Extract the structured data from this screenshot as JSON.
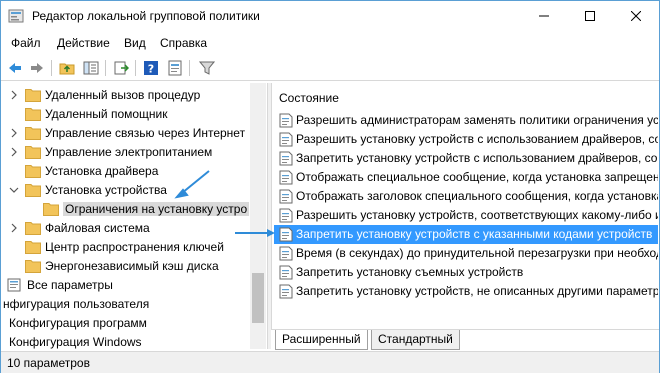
{
  "window": {
    "title": "Редактор локальной групповой политики",
    "icon": "gpedit-icon"
  },
  "menu": [
    "Файл",
    "Действие",
    "Вид",
    "Справка"
  ],
  "toolbar": {
    "icons": [
      "back-arrow-icon",
      "forward-arrow-icon",
      "up-folder-icon",
      "show-hide-tree-icon",
      "export-list-icon",
      "help-icon",
      "properties-icon",
      "filter-icon"
    ]
  },
  "tree": {
    "items": [
      {
        "label": "Удаленный вызов процедур",
        "expandable": true,
        "expanded": false,
        "indent": 1
      },
      {
        "label": "Удаленный помощник",
        "expandable": false,
        "expanded": false,
        "indent": 1
      },
      {
        "label": "Управление связью через Интернет",
        "expandable": true,
        "expanded": false,
        "indent": 1
      },
      {
        "label": "Управление электропитанием",
        "expandable": true,
        "expanded": false,
        "indent": 1
      },
      {
        "label": "Установка драйвера",
        "expandable": false,
        "expanded": false,
        "indent": 1
      },
      {
        "label": "Установка устройства",
        "expandable": true,
        "expanded": true,
        "indent": 1
      },
      {
        "label": "Ограничения на установку устро",
        "expandable": false,
        "expanded": false,
        "indent": 2,
        "selected": true
      },
      {
        "label": "Файловая система",
        "expandable": true,
        "expanded": false,
        "indent": 1
      },
      {
        "label": "Центр распространения ключей",
        "expandable": false,
        "expanded": false,
        "indent": 1
      },
      {
        "label": "Энергонезависимый кэш диска",
        "expandable": false,
        "expanded": false,
        "indent": 1
      },
      {
        "label": "Все параметры",
        "expandable": false,
        "expanded": false,
        "indent": 0,
        "icon": "all-settings-icon"
      },
      {
        "label": "нфигурация пользователя",
        "expandable": false,
        "expanded": false,
        "indent": -1,
        "icon": "none"
      },
      {
        "label": "Конфигурация программ",
        "expandable": false,
        "expanded": false,
        "indent": -1,
        "icon": "none"
      },
      {
        "label": "Конфигурация Windows",
        "expandable": false,
        "expanded": false,
        "indent": -1,
        "icon": "none"
      }
    ]
  },
  "list": {
    "header": "Состояние",
    "items": [
      {
        "label": "Разрешить администраторам заменять политики ограничения устр",
        "selected": false
      },
      {
        "label": "Разрешить установку устройств с использованием драйверов, соот",
        "selected": false
      },
      {
        "label": "Запретить установку устройств с использованием драйверов, соот",
        "selected": false
      },
      {
        "label": "Отображать специальное сообщение, когда установка запрещена п",
        "selected": false
      },
      {
        "label": "Отображать заголовок специального сообщения, когда установка",
        "selected": false
      },
      {
        "label": "Разрешить установку устройств, соответствующих какому-либо из",
        "selected": false
      },
      {
        "label": "Запретить установку устройств с указанными кодами устройств",
        "selected": true
      },
      {
        "label": "Время (в секундах) до принудительной перезагрузки при необход",
        "selected": false
      },
      {
        "label": "Запретить установку съемных устройств",
        "selected": false
      },
      {
        "label": "Запретить установку устройств, не описанных другими параметра",
        "selected": false
      }
    ]
  },
  "tabs": [
    {
      "label": "Расширенный",
      "active": true
    },
    {
      "label": "Стандартный",
      "active": false
    }
  ],
  "status": {
    "text": "10 параметров"
  },
  "colors": {
    "selection": "#3399ff",
    "annotation_arrow": "#2e8bd8",
    "folder": "#f2c45a"
  }
}
